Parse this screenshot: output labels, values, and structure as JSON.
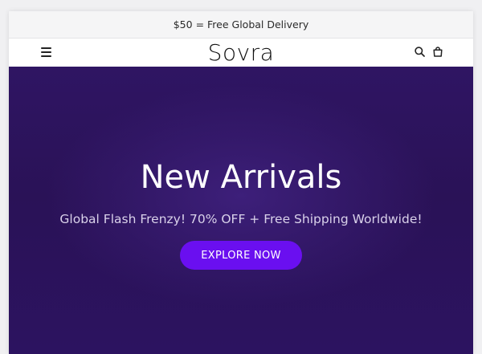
{
  "announcement": {
    "text": "$50 = Free Global Delivery"
  },
  "header": {
    "logo": "Sovra",
    "menu_icon": "menu-icon",
    "search_icon": "search-icon",
    "cart_icon": "shopping-bag-icon"
  },
  "hero": {
    "title": "New Arrivals",
    "subtitle": "Global Flash Frenzy! 70% OFF + Free Shipping Worldwide!",
    "cta_label": "EXPLORE NOW"
  },
  "colors": {
    "hero_background": "#2c1360",
    "cta_background": "#6a0ff0",
    "announcement_background": "#f5f5f6"
  }
}
